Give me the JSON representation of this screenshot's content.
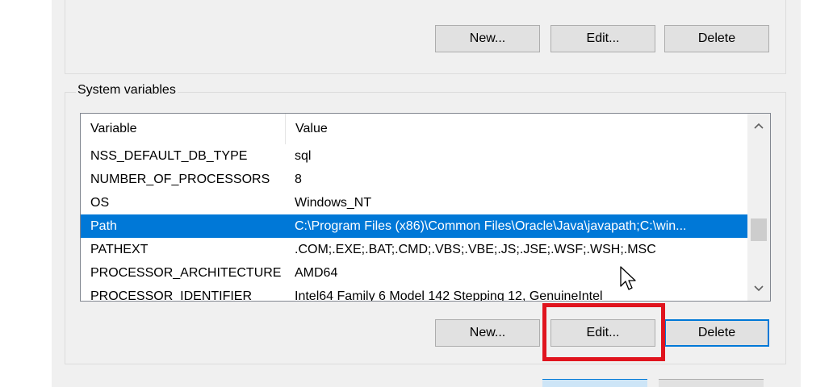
{
  "user_buttons": {
    "new": "New...",
    "edit": "Edit...",
    "delete": "Delete"
  },
  "system_variables": {
    "group_label": "System variables",
    "columns": {
      "variable": "Variable",
      "value": "Value"
    },
    "rows": [
      {
        "name": "NSS_DEFAULT_DB_TYPE",
        "value": "sql"
      },
      {
        "name": "NUMBER_OF_PROCESSORS",
        "value": "8"
      },
      {
        "name": "OS",
        "value": "Windows_NT"
      },
      {
        "name": "Path",
        "value": "C:\\Program Files (x86)\\Common Files\\Oracle\\Java\\javapath;C:\\win...",
        "selected": true
      },
      {
        "name": "PATHEXT",
        "value": ".COM;.EXE;.BAT;.CMD;.VBS;.VBE;.JS;.JSE;.WSF;.WSH;.MSC"
      },
      {
        "name": "PROCESSOR_ARCHITECTURE",
        "value": "AMD64"
      },
      {
        "name": "PROCESSOR_IDENTIFIER",
        "value": "Intel64 Family 6 Model 142 Stepping 12, GenuineIntel"
      }
    ],
    "buttons": {
      "new": "New...",
      "edit": "Edit...",
      "delete": "Delete"
    }
  },
  "colors": {
    "selection": "#0078d7",
    "highlight_box": "#e0141e"
  },
  "icons": {
    "scroll_up": "chevron-up-icon",
    "scroll_down": "chevron-down-icon",
    "pointer": "mouse-cursor-icon"
  }
}
